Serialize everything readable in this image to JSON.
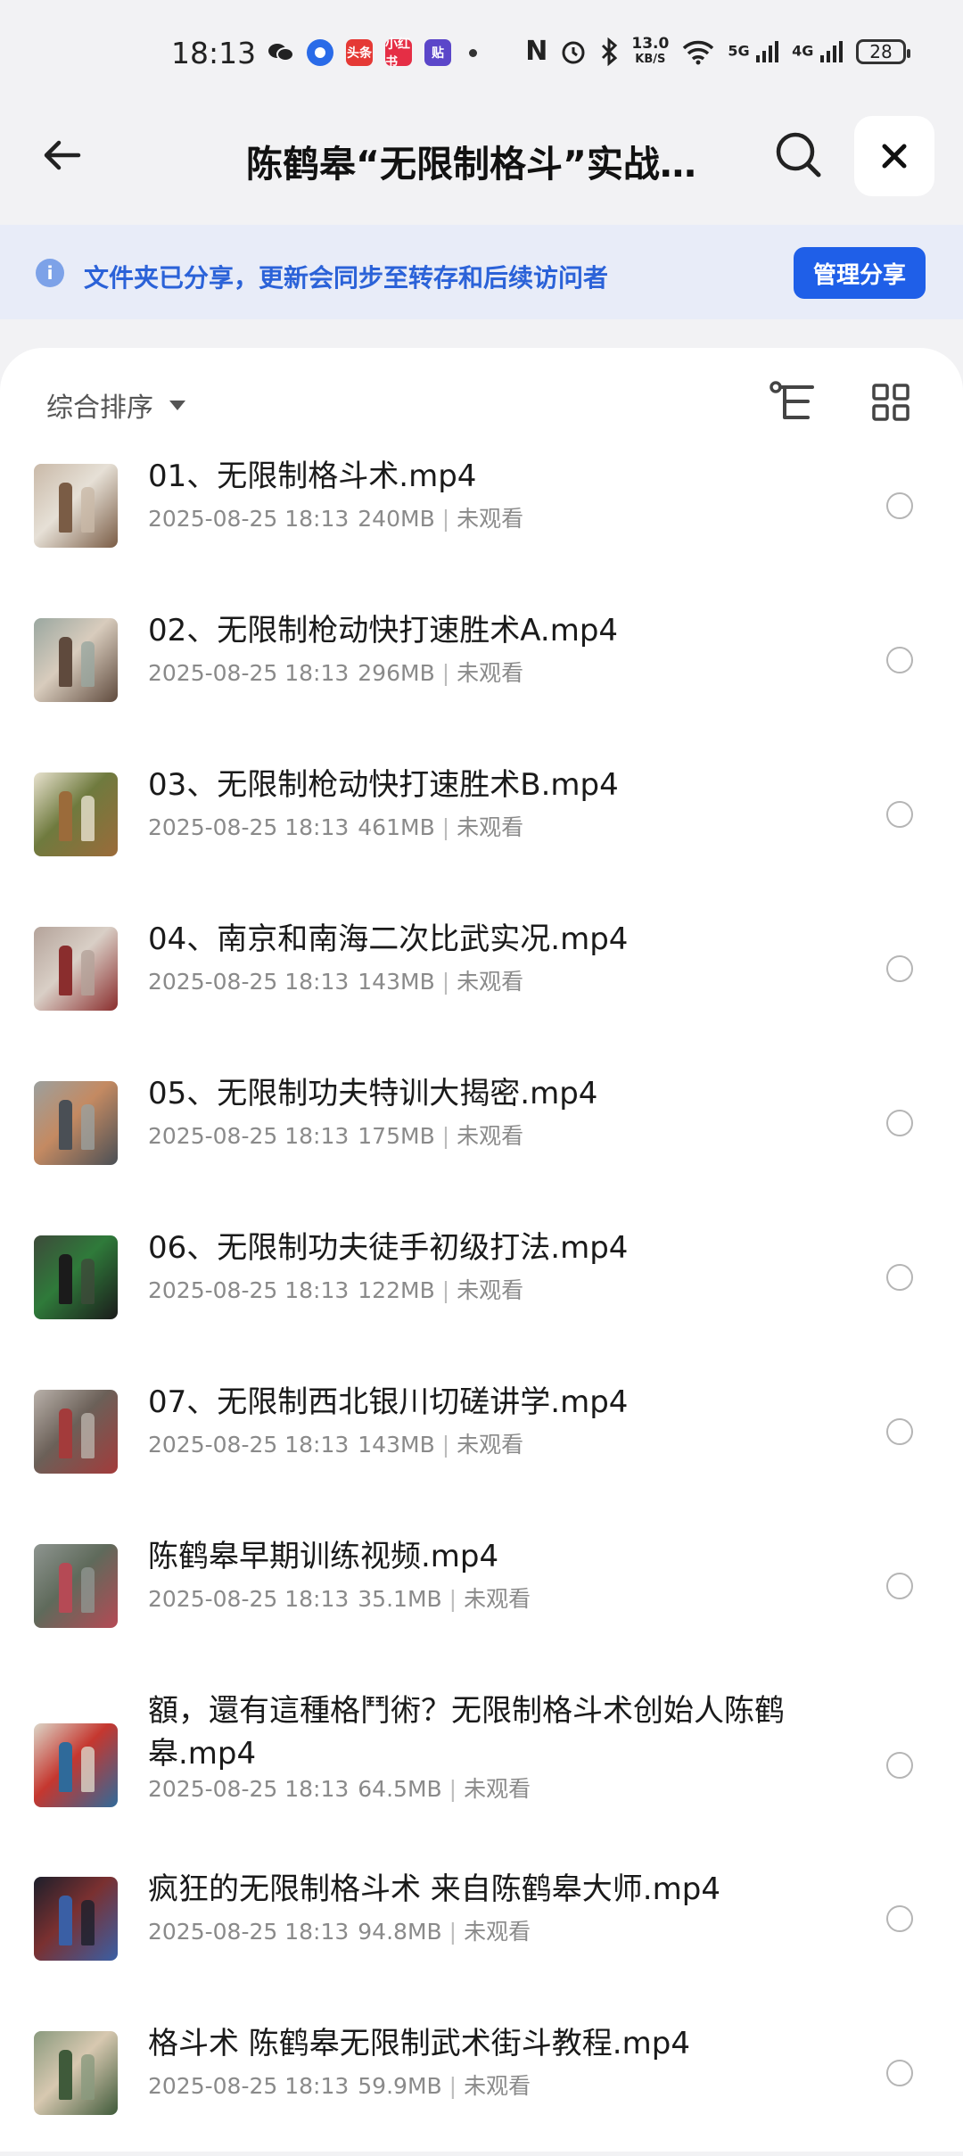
{
  "status_bar": {
    "time": "18:13",
    "app_icons": [
      {
        "name": "wechat-icon",
        "color": "#111111",
        "text": ""
      },
      {
        "name": "browser-icon",
        "color": "#2a6be8",
        "text": ""
      },
      {
        "name": "toutiao-icon",
        "color": "#e53935",
        "text": "头条"
      },
      {
        "name": "xiaohongshu-icon",
        "color": "#e52e45",
        "text": "小红书"
      },
      {
        "name": "tieba-icon",
        "color": "#5b46c9",
        "text": "贴"
      }
    ],
    "net_speed_value": "13.0",
    "net_speed_unit": "KB/S",
    "signal_5g": "5G",
    "signal_4g": "4G",
    "battery": "28"
  },
  "header": {
    "title": "陈鹤皋“无限制格斗”实战训..."
  },
  "banner": {
    "text": "文件夹已分享，更新会同步至转存和后续访问者",
    "manage_label": "管理分享",
    "accent": "#1f5fe8"
  },
  "toolbar": {
    "sort_label": "综合排序"
  },
  "files": [
    {
      "name": "01、无限制格斗术.mp4",
      "date": "2025-08-25 18:13",
      "size": "240MB",
      "status": "未观看",
      "thumb": [
        "#c9b9a8",
        "#7a5c45",
        "#e6e0d6"
      ]
    },
    {
      "name": "02、无限制枪动快打速胜术A.mp4",
      "date": "2025-08-25 18:13",
      "size": "296MB",
      "status": "未观看",
      "thumb": [
        "#9aa7a0",
        "#5f4a3d",
        "#d8ccbd"
      ]
    },
    {
      "name": "03、无限制枪动快打速胜术B.mp4",
      "date": "2025-08-25 18:13",
      "size": "461MB",
      "status": "未观看",
      "thumb": [
        "#e8e2cf",
        "#9b6b3a",
        "#6f7a3e"
      ]
    },
    {
      "name": "04、南京和南海二次比武实况.mp4",
      "date": "2025-08-25 18:13",
      "size": "143MB",
      "status": "未观看",
      "thumb": [
        "#b4a39a",
        "#8a2d2d",
        "#d9cfc6"
      ]
    },
    {
      "name": "05、无限制功夫特训大揭密.mp4",
      "date": "2025-08-25 18:13",
      "size": "175MB",
      "status": "未观看",
      "thumb": [
        "#9ba09e",
        "#4a4f55",
        "#c48a62"
      ]
    },
    {
      "name": "06、无限制功夫徒手初级打法.mp4",
      "date": "2025-08-25 18:13",
      "size": "122MB",
      "status": "未观看",
      "thumb": [
        "#3d4a3a",
        "#1b1b1b",
        "#2f7a3a"
      ]
    },
    {
      "name": "07、无限制西北银川切磋讲学.mp4",
      "date": "2025-08-25 18:13",
      "size": "143MB",
      "status": "未观看",
      "thumb": [
        "#b9b1aa",
        "#a33b3b",
        "#6b6058"
      ]
    },
    {
      "name": "陈鹤皋早期训练视频.mp4",
      "date": "2025-08-25 18:13",
      "size": "35.1MB",
      "status": "未观看",
      "thumb": [
        "#8e9590",
        "#b54a55",
        "#5f6a5b"
      ]
    },
    {
      "name": "額，還有這種格鬥術？无限制格斗术创始人陈鹤皋.mp4",
      "date": "2025-08-25 18:13",
      "size": "64.5MB",
      "status": "未观看",
      "thumb": [
        "#dcd6c8",
        "#2f6a9a",
        "#c5372f"
      ]
    },
    {
      "name": "疯狂的无限制格斗术 来自陈鹤皋大师.mp4",
      "date": "2025-08-25 18:13",
      "size": "94.8MB",
      "status": "未观看",
      "thumb": [
        "#1c1f2b",
        "#3a5fa5",
        "#7a3030"
      ]
    },
    {
      "name": "格斗术 陈鹤皋无限制武术街斗教程.mp4",
      "date": "2025-08-25 18:13",
      "size": "59.9MB",
      "status": "未观看",
      "thumb": [
        "#8a9a7e",
        "#3f5a3a",
        "#d7c8b0"
      ]
    }
  ]
}
